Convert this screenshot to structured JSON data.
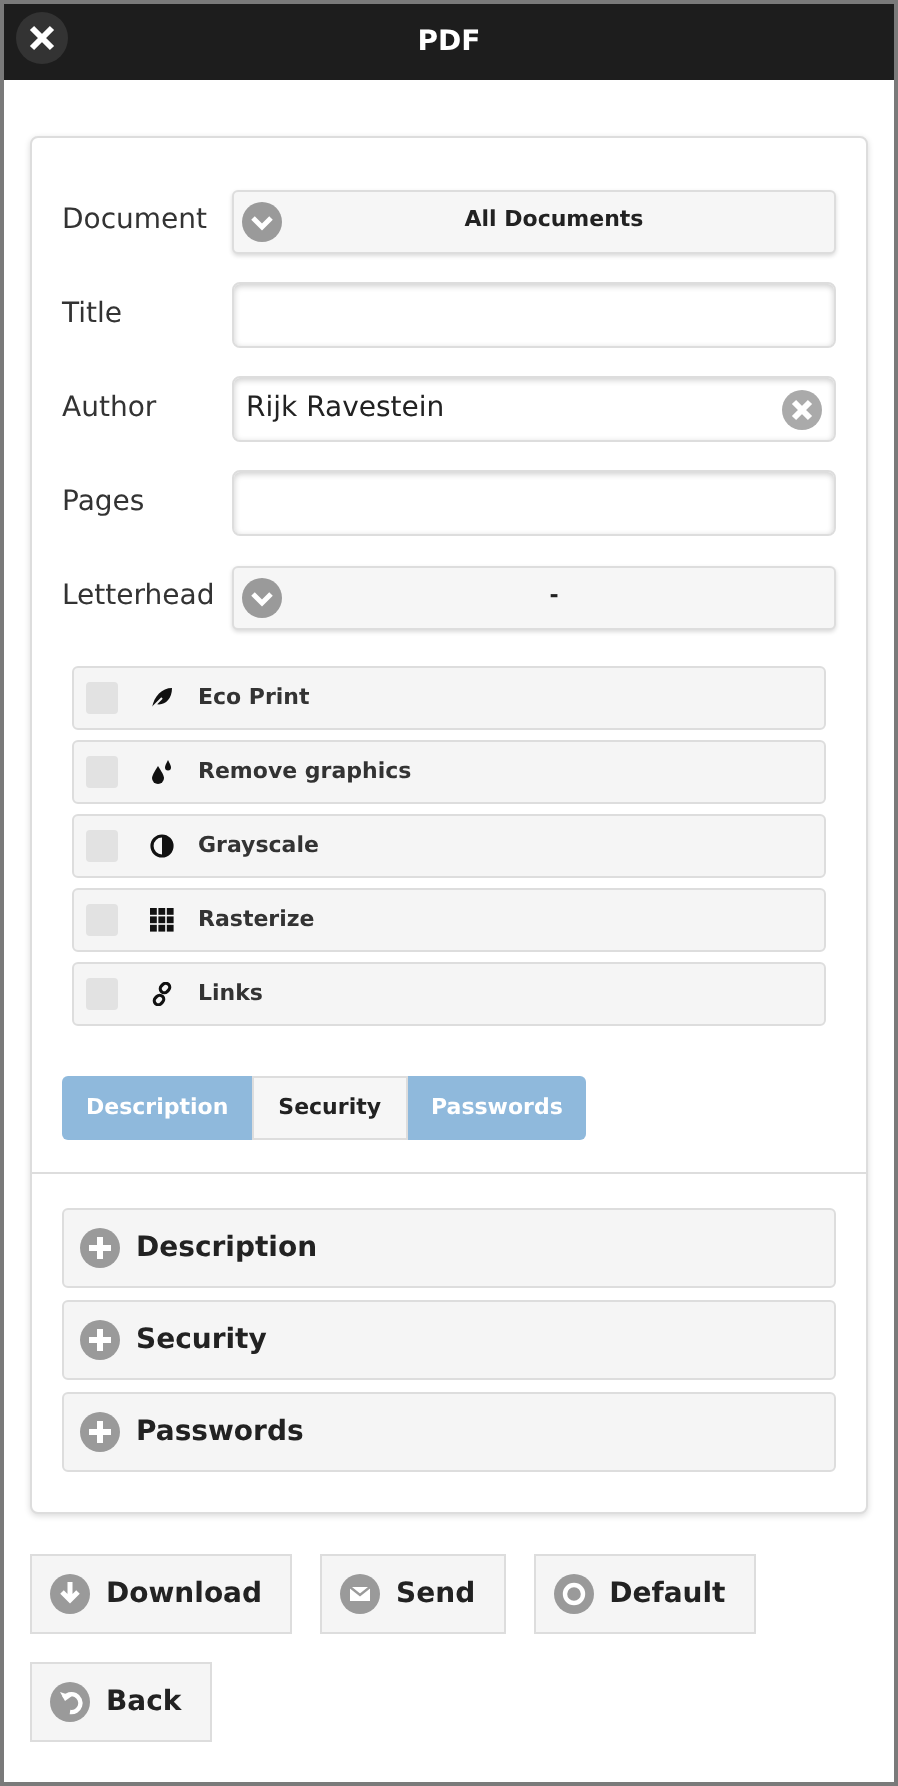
{
  "header": {
    "title": "PDF"
  },
  "fields": [
    {
      "kind": "select",
      "label": "Document",
      "value": "All Documents"
    },
    {
      "kind": "text",
      "label": "Title"
    },
    {
      "kind": "text",
      "label": "Author",
      "value": "Rijk Ravestein"
    },
    {
      "kind": "text",
      "label": "Pages"
    },
    {
      "kind": "select",
      "label": "Letterhead",
      "value": "-"
    }
  ],
  "options": [
    {
      "label": "Eco Print",
      "checked": false
    },
    {
      "label": "Remove graphics",
      "checked": false
    },
    {
      "label": "Grayscale",
      "checked": false
    },
    {
      "label": "Rasterize",
      "checked": false
    },
    {
      "label": "Links",
      "checked": false
    }
  ],
  "tabs": [
    {
      "label": "Description",
      "selected": false
    },
    {
      "label": "Security",
      "selected": true
    },
    {
      "label": "Passwords",
      "selected": false
    }
  ],
  "sections": [
    {
      "label": "Description",
      "expanded": false
    },
    {
      "label": "Security",
      "expanded": false
    },
    {
      "label": "Passwords",
      "expanded": false
    }
  ],
  "buttons": [
    "Download",
    "Send",
    "Default",
    "Back"
  ]
}
